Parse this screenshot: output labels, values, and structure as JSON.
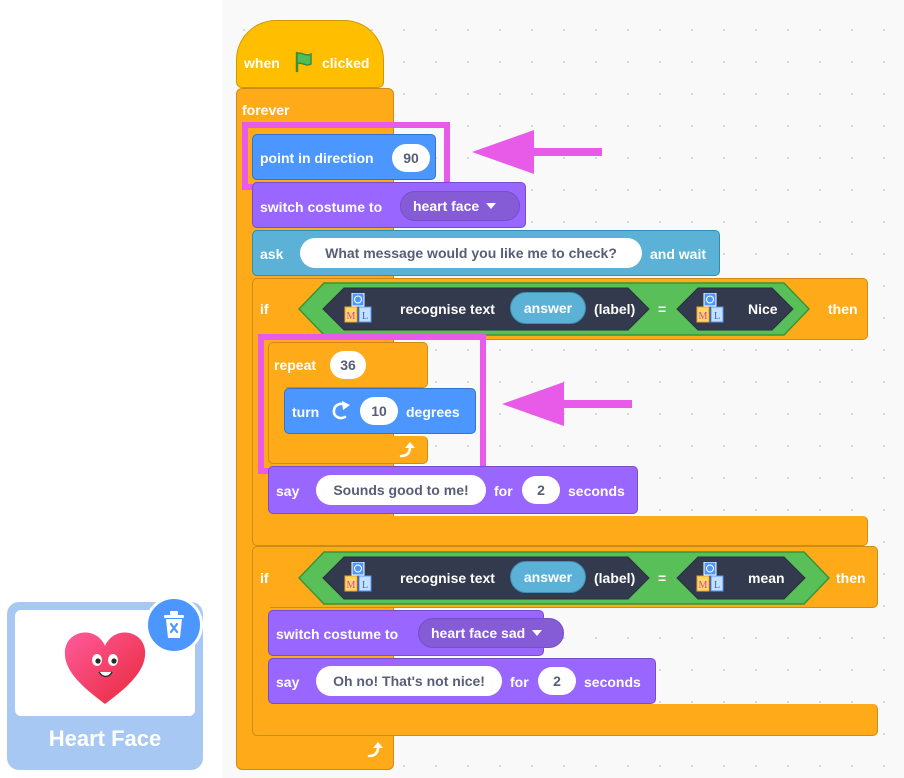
{
  "blocks": {
    "hat": {
      "pre": "when",
      "post": "clicked"
    },
    "forever": "forever",
    "point": {
      "label": "point in direction",
      "value": "90"
    },
    "switch1": {
      "label": "switch costume to",
      "costume": "heart face"
    },
    "ask": {
      "label": "ask",
      "question": "What message would you like me to check?",
      "wait": "and wait"
    },
    "if1": {
      "if": "if",
      "then": "then",
      "op": "recognise text",
      "answer": "answer",
      "label": "(label)",
      "eq": "=",
      "value": "Nice"
    },
    "repeat": {
      "label": "repeat",
      "value": "36"
    },
    "turn": {
      "label": "turn",
      "value": "10",
      "degrees": "degrees"
    },
    "say1": {
      "label": "say",
      "text": "Sounds good to me!",
      "for": "for",
      "secs": "2",
      "seconds": "seconds"
    },
    "if2": {
      "if": "if",
      "then": "then",
      "op": "recognise text",
      "answer": "answer",
      "label": "(label)",
      "eq": "=",
      "value": "mean"
    },
    "switch2": {
      "label": "switch costume to",
      "costume": "heart face sad"
    },
    "say2": {
      "label": "say",
      "text": "Oh no! That's not nice!",
      "for": "for",
      "secs": "2",
      "seconds": "seconds"
    }
  },
  "ml_icon": {
    "top": "M",
    "bottom_left": "M",
    "bottom_right": "L"
  },
  "sprite": {
    "name": "Heart Face"
  },
  "colors": {
    "events": "#ffbf00",
    "control": "#ffab19",
    "motion": "#4c97ff",
    "looks": "#9966ff",
    "sensing": "#5cb1d6",
    "ml": "#333a4d",
    "operators": "#59c059",
    "annotation": "#e85be8"
  }
}
